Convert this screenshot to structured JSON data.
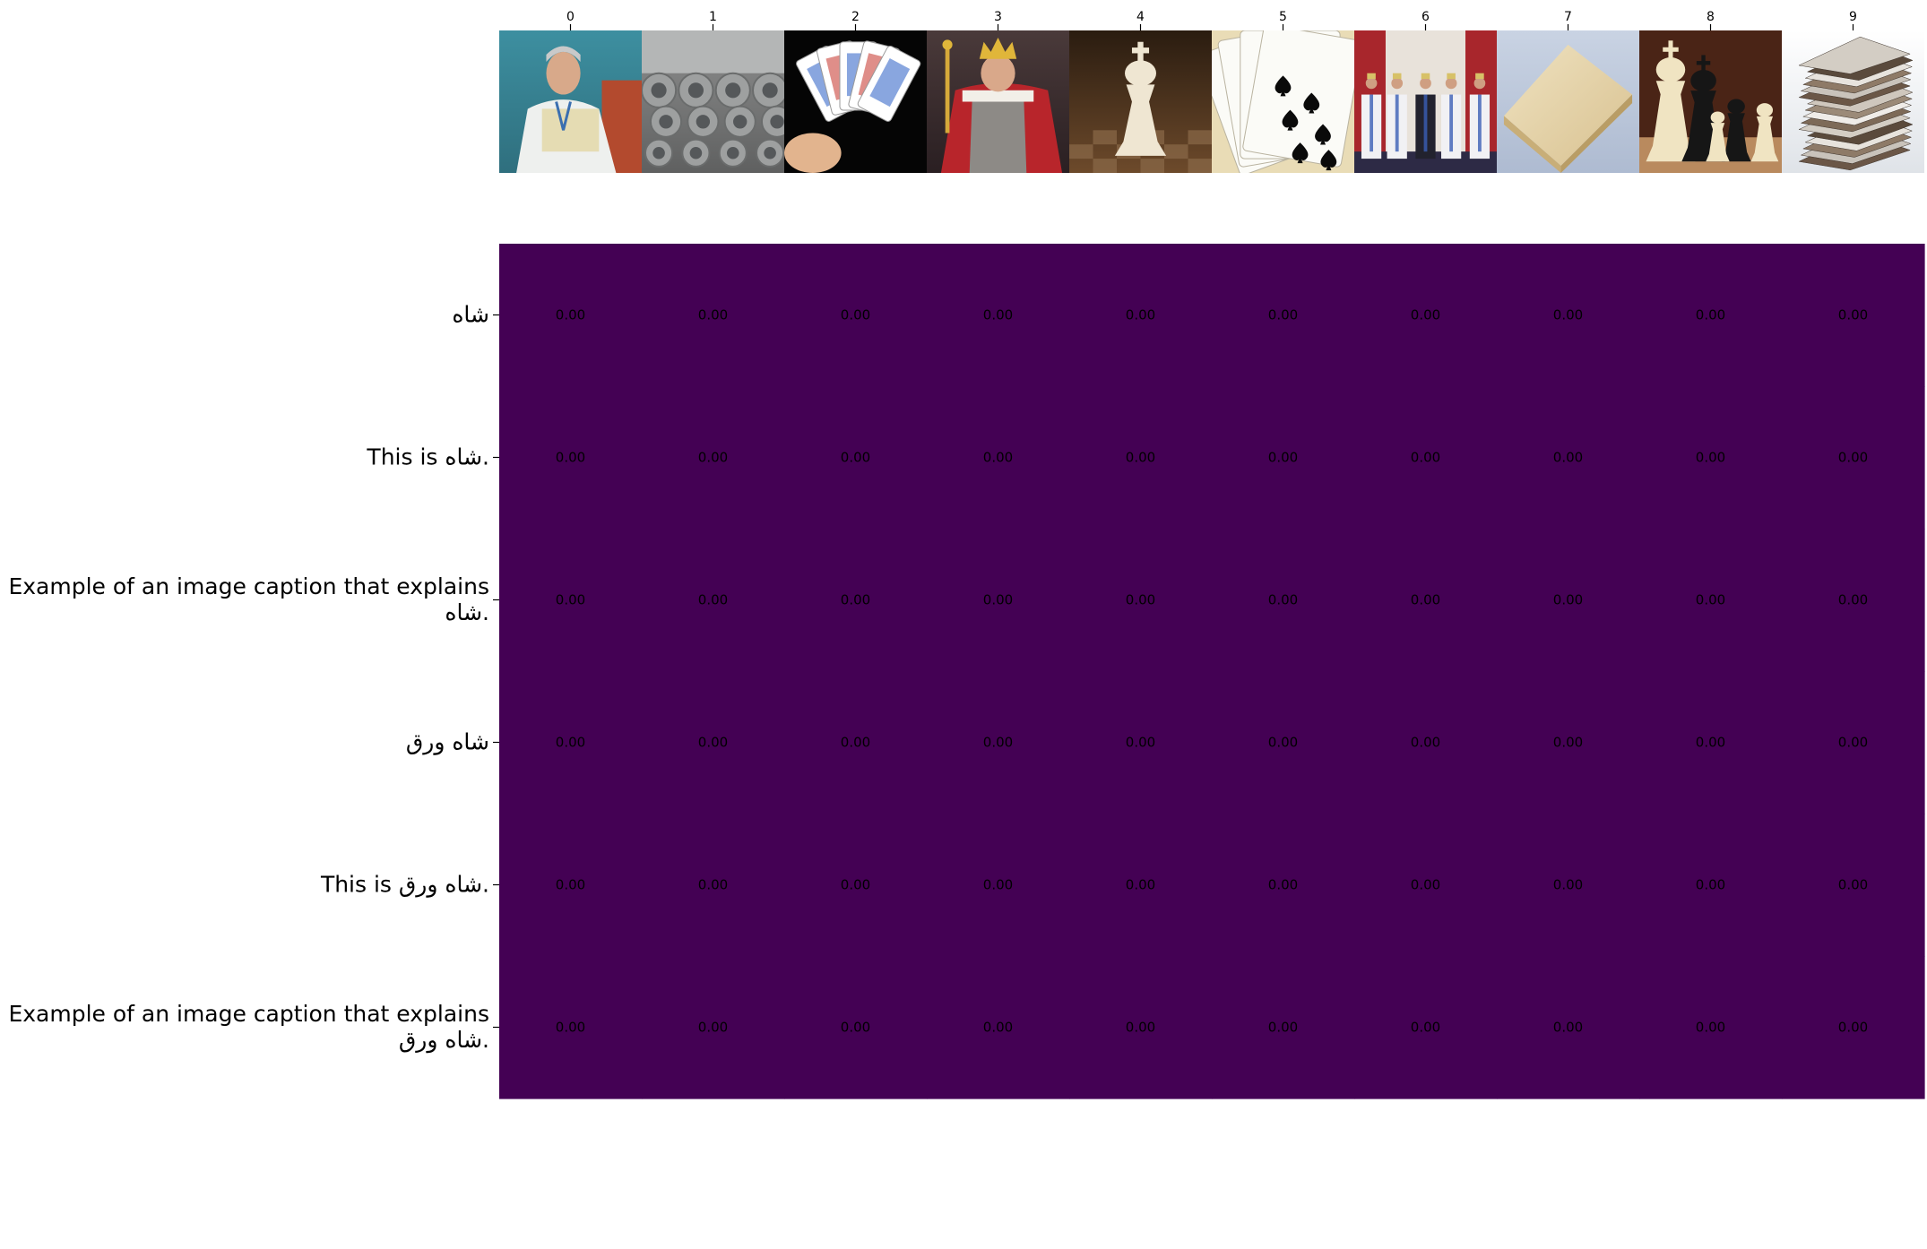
{
  "chart_data": {
    "type": "heatmap",
    "title": "",
    "xlabel": "",
    "ylabel": "",
    "x_tick_labels": [
      "0",
      "1",
      "2",
      "3",
      "4",
      "5",
      "6",
      "7",
      "8",
      "9"
    ],
    "image_thumbnails": [
      {
        "index": "0",
        "depicts": "portrait-of-shah-in-white-uniform"
      },
      {
        "index": "1",
        "depicts": "steel-coils-in-warehouse"
      },
      {
        "index": "2",
        "depicts": "hand-holding-playing-cards"
      },
      {
        "index": "3",
        "depicts": "painted-king-with-crown-and-scepter"
      },
      {
        "index": "4",
        "depicts": "white-chess-king-on-board"
      },
      {
        "index": "5",
        "depicts": "fanned-spade-playing-cards"
      },
      {
        "index": "6",
        "depicts": "royal-family-group-photo"
      },
      {
        "index": "7",
        "depicts": "stack-of-beige-paper"
      },
      {
        "index": "8",
        "depicts": "chess-pieces-set"
      },
      {
        "index": "9",
        "depicts": "stack-of-thin-sheets"
      }
    ],
    "y_tick_labels": [
      [
        "شاه"
      ],
      [
        "This is شاه."
      ],
      [
        "Example of an image caption that explains",
        "شاه."
      ],
      [
        "شاه ورق"
      ],
      [
        "This is شاه ورق."
      ],
      [
        "Example of an image caption that explains",
        "شاه ورق."
      ]
    ],
    "values": [
      [
        0.0,
        0.0,
        0.0,
        0.0,
        0.0,
        0.0,
        0.0,
        0.0,
        0.0,
        0.0
      ],
      [
        0.0,
        0.0,
        0.0,
        0.0,
        0.0,
        0.0,
        0.0,
        0.0,
        0.0,
        0.0
      ],
      [
        0.0,
        0.0,
        0.0,
        0.0,
        0.0,
        0.0,
        0.0,
        0.0,
        0.0,
        0.0
      ],
      [
        0.0,
        0.0,
        0.0,
        0.0,
        0.0,
        0.0,
        0.0,
        0.0,
        0.0,
        0.0
      ],
      [
        0.0,
        0.0,
        0.0,
        0.0,
        0.0,
        0.0,
        0.0,
        0.0,
        0.0,
        0.0
      ],
      [
        0.0,
        0.0,
        0.0,
        0.0,
        0.0,
        0.0,
        0.0,
        0.0,
        0.0,
        0.0
      ]
    ],
    "cell_labels": [
      [
        "0.00",
        "0.00",
        "0.00",
        "0.00",
        "0.00",
        "0.00",
        "0.00",
        "0.00",
        "0.00",
        "0.00"
      ],
      [
        "0.00",
        "0.00",
        "0.00",
        "0.00",
        "0.00",
        "0.00",
        "0.00",
        "0.00",
        "0.00",
        "0.00"
      ],
      [
        "0.00",
        "0.00",
        "0.00",
        "0.00",
        "0.00",
        "0.00",
        "0.00",
        "0.00",
        "0.00",
        "0.00"
      ],
      [
        "0.00",
        "0.00",
        "0.00",
        "0.00",
        "0.00",
        "0.00",
        "0.00",
        "0.00",
        "0.00",
        "0.00"
      ],
      [
        "0.00",
        "0.00",
        "0.00",
        "0.00",
        "0.00",
        "0.00",
        "0.00",
        "0.00",
        "0.00",
        "0.00"
      ],
      [
        "0.00",
        "0.00",
        "0.00",
        "0.00",
        "0.00",
        "0.00",
        "0.00",
        "0.00",
        "0.00",
        "0.00"
      ]
    ],
    "colormap": "viridis",
    "cell_color": "#440154",
    "value_range": [
      0.0,
      1.0
    ],
    "grid": false,
    "legend": "none"
  }
}
